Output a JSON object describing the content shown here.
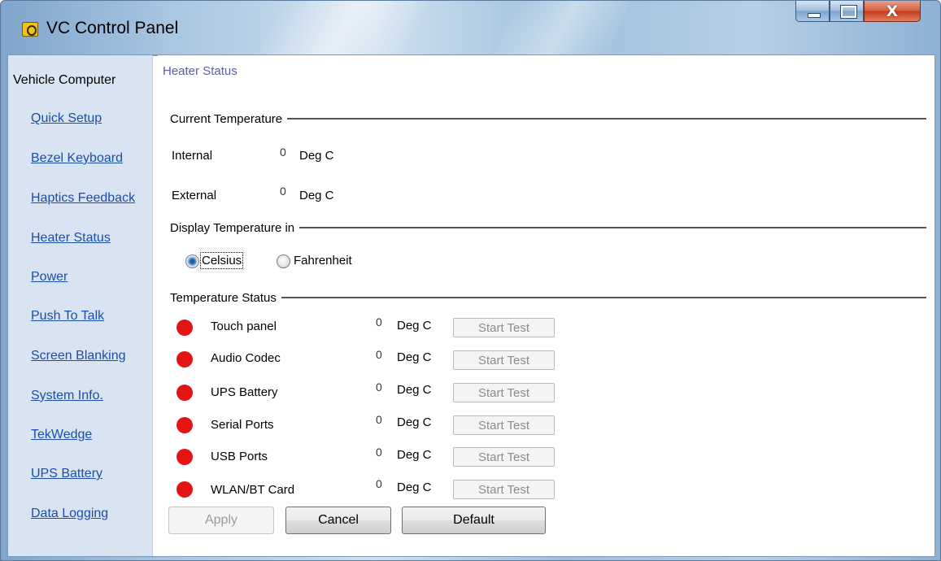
{
  "window": {
    "title": "VC Control Panel",
    "close_glyph": "X"
  },
  "sidebar": {
    "header": "Vehicle Computer",
    "items": [
      {
        "label": "Quick Setup"
      },
      {
        "label": "Bezel Keyboard"
      },
      {
        "label": "Haptics Feedback"
      },
      {
        "label": "Heater Status"
      },
      {
        "label": "Power"
      },
      {
        "label": "Push To Talk"
      },
      {
        "label": "Screen Blanking"
      },
      {
        "label": "System Info."
      },
      {
        "label": "TekWedge"
      },
      {
        "label": "UPS Battery"
      },
      {
        "label": "Data Logging"
      }
    ]
  },
  "page": {
    "title": "Heater Status"
  },
  "current_temperature": {
    "label": "Current Temperature",
    "internal": {
      "label": "Internal",
      "value": "0",
      "unit": "Deg C"
    },
    "external": {
      "label": "External",
      "value": "0",
      "unit": "Deg C"
    }
  },
  "display_temperature": {
    "label": "Display Temperature in",
    "options": [
      {
        "label": "Celsius",
        "selected": true
      },
      {
        "label": "Fahrenheit",
        "selected": false
      }
    ]
  },
  "temperature_status": {
    "label": "Temperature Status",
    "status_color": "#e51414",
    "rows": [
      {
        "name": "Touch panel",
        "value": "0",
        "unit": "Deg C",
        "button": "Start Test"
      },
      {
        "name": "Audio Codec",
        "value": "0",
        "unit": "Deg C",
        "button": "Start Test"
      },
      {
        "name": "UPS Battery",
        "value": "0",
        "unit": "Deg C",
        "button": "Start Test"
      },
      {
        "name": "Serial Ports",
        "value": "0",
        "unit": "Deg C",
        "button": "Start Test"
      },
      {
        "name": "USB Ports",
        "value": "0",
        "unit": "Deg C",
        "button": "Start Test"
      },
      {
        "name": "WLAN/BT Card",
        "value": "0",
        "unit": "Deg C",
        "button": "Start Test"
      }
    ]
  },
  "actions": {
    "apply": "Apply",
    "cancel": "Cancel",
    "default": "Default"
  }
}
